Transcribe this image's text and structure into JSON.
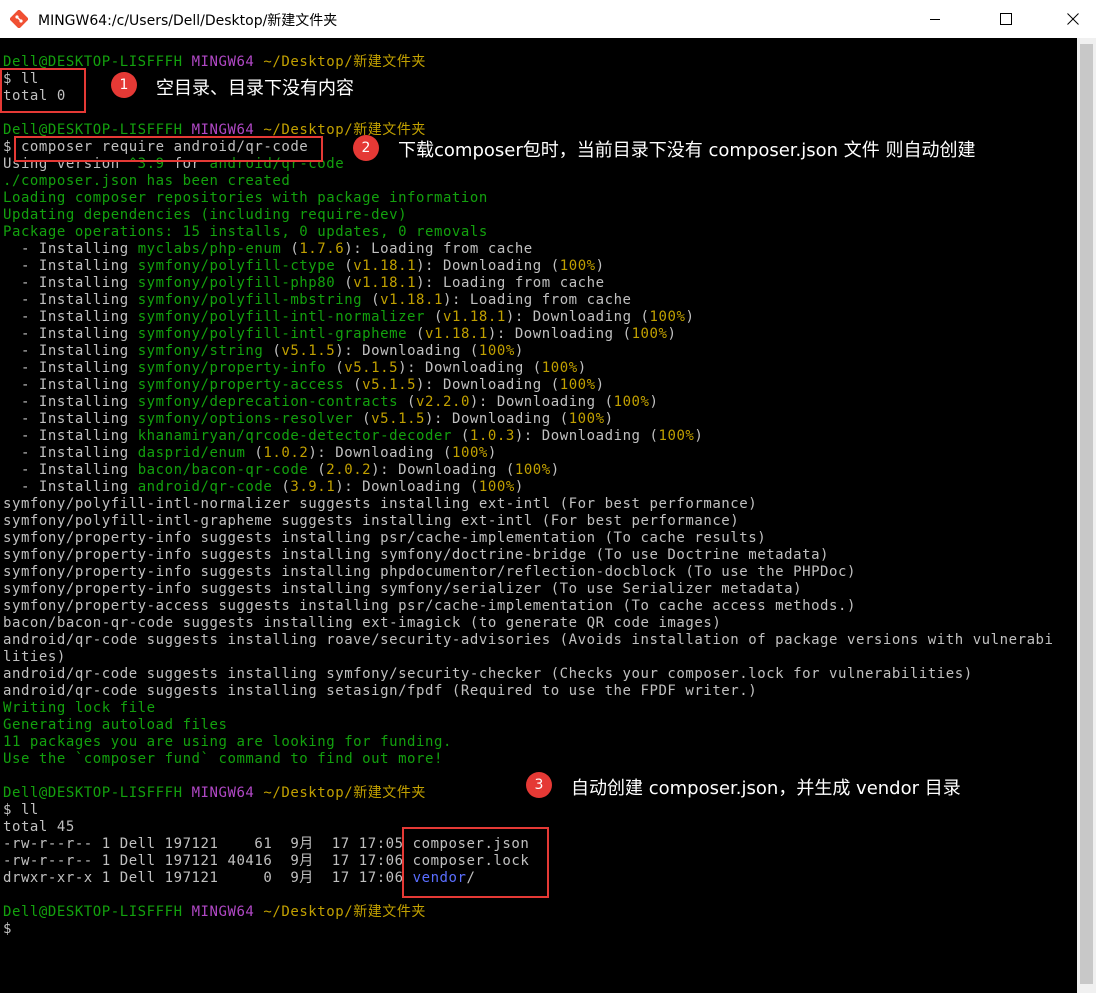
{
  "window": {
    "title": "MINGW64:/c/Users/Dell/Desktop/新建文件夹",
    "icons": [
      "git-bash-icon",
      "minimize-icon",
      "maximize-icon",
      "close-icon"
    ]
  },
  "colors": {
    "default": "#c0c0c0",
    "green": "#13a10e",
    "magenta": "#b148c6",
    "yellow": "#c1a000",
    "blue": "#5a6eff",
    "annotation_red": "#e53935"
  },
  "terminal": {
    "lines": [
      [
        {
          "t": "Dell@DESKTOP-LISFFFH ",
          "c": "green"
        },
        {
          "t": "MINGW64 ",
          "c": "magenta"
        },
        {
          "t": "~/Desktop/新建文件夹",
          "c": "yellow"
        }
      ],
      [
        {
          "t": "$ ll",
          "c": "default"
        }
      ],
      [
        {
          "t": "total 0",
          "c": "default"
        }
      ],
      [],
      [
        {
          "t": "Dell@DESKTOP-LISFFFH ",
          "c": "green"
        },
        {
          "t": "MINGW64 ",
          "c": "magenta"
        },
        {
          "t": "~/Desktop/新建文件夹",
          "c": "yellow"
        }
      ],
      [
        {
          "t": "$ composer require android/qr-code",
          "c": "default"
        }
      ],
      [
        {
          "t": "Using version ",
          "c": "default"
        },
        {
          "t": "^3.9",
          "c": "green"
        },
        {
          "t": " for ",
          "c": "default"
        },
        {
          "t": "android/qr-code",
          "c": "green"
        }
      ],
      [
        {
          "t": "./composer.json has been created",
          "c": "green"
        }
      ],
      [
        {
          "t": "Loading composer repositories with package information",
          "c": "green"
        }
      ],
      [
        {
          "t": "Updating dependencies (including require-dev)",
          "c": "green"
        }
      ],
      [
        {
          "t": "Package operations: 15 installs, 0 updates, 0 removals",
          "c": "green"
        }
      ],
      [
        {
          "t": "  - Installing ",
          "c": "default"
        },
        {
          "t": "myclabs/php-enum",
          "c": "green"
        },
        {
          "t": " (",
          "c": "default"
        },
        {
          "t": "1.7.6",
          "c": "yellow"
        },
        {
          "t": "): Loading from cache",
          "c": "default"
        }
      ],
      [
        {
          "t": "  - Installing ",
          "c": "default"
        },
        {
          "t": "symfony/polyfill-ctype",
          "c": "green"
        },
        {
          "t": " (",
          "c": "default"
        },
        {
          "t": "v1.18.1",
          "c": "yellow"
        },
        {
          "t": "): Downloading (",
          "c": "default"
        },
        {
          "t": "100%",
          "c": "yellow"
        },
        {
          "t": ")",
          "c": "default"
        }
      ],
      [
        {
          "t": "  - Installing ",
          "c": "default"
        },
        {
          "t": "symfony/polyfill-php80",
          "c": "green"
        },
        {
          "t": " (",
          "c": "default"
        },
        {
          "t": "v1.18.1",
          "c": "yellow"
        },
        {
          "t": "): Loading from cache",
          "c": "default"
        }
      ],
      [
        {
          "t": "  - Installing ",
          "c": "default"
        },
        {
          "t": "symfony/polyfill-mbstring",
          "c": "green"
        },
        {
          "t": " (",
          "c": "default"
        },
        {
          "t": "v1.18.1",
          "c": "yellow"
        },
        {
          "t": "): Loading from cache",
          "c": "default"
        }
      ],
      [
        {
          "t": "  - Installing ",
          "c": "default"
        },
        {
          "t": "symfony/polyfill-intl-normalizer",
          "c": "green"
        },
        {
          "t": " (",
          "c": "default"
        },
        {
          "t": "v1.18.1",
          "c": "yellow"
        },
        {
          "t": "): Downloading (",
          "c": "default"
        },
        {
          "t": "100%",
          "c": "yellow"
        },
        {
          "t": ")",
          "c": "default"
        }
      ],
      [
        {
          "t": "  - Installing ",
          "c": "default"
        },
        {
          "t": "symfony/polyfill-intl-grapheme",
          "c": "green"
        },
        {
          "t": " (",
          "c": "default"
        },
        {
          "t": "v1.18.1",
          "c": "yellow"
        },
        {
          "t": "): Downloading (",
          "c": "default"
        },
        {
          "t": "100%",
          "c": "yellow"
        },
        {
          "t": ")",
          "c": "default"
        }
      ],
      [
        {
          "t": "  - Installing ",
          "c": "default"
        },
        {
          "t": "symfony/string",
          "c": "green"
        },
        {
          "t": " (",
          "c": "default"
        },
        {
          "t": "v5.1.5",
          "c": "yellow"
        },
        {
          "t": "): Downloading (",
          "c": "default"
        },
        {
          "t": "100%",
          "c": "yellow"
        },
        {
          "t": ")",
          "c": "default"
        }
      ],
      [
        {
          "t": "  - Installing ",
          "c": "default"
        },
        {
          "t": "symfony/property-info",
          "c": "green"
        },
        {
          "t": " (",
          "c": "default"
        },
        {
          "t": "v5.1.5",
          "c": "yellow"
        },
        {
          "t": "): Downloading (",
          "c": "default"
        },
        {
          "t": "100%",
          "c": "yellow"
        },
        {
          "t": ")",
          "c": "default"
        }
      ],
      [
        {
          "t": "  - Installing ",
          "c": "default"
        },
        {
          "t": "symfony/property-access",
          "c": "green"
        },
        {
          "t": " (",
          "c": "default"
        },
        {
          "t": "v5.1.5",
          "c": "yellow"
        },
        {
          "t": "): Downloading (",
          "c": "default"
        },
        {
          "t": "100%",
          "c": "yellow"
        },
        {
          "t": ")",
          "c": "default"
        }
      ],
      [
        {
          "t": "  - Installing ",
          "c": "default"
        },
        {
          "t": "symfony/deprecation-contracts",
          "c": "green"
        },
        {
          "t": " (",
          "c": "default"
        },
        {
          "t": "v2.2.0",
          "c": "yellow"
        },
        {
          "t": "): Downloading (",
          "c": "default"
        },
        {
          "t": "100%",
          "c": "yellow"
        },
        {
          "t": ")",
          "c": "default"
        }
      ],
      [
        {
          "t": "  - Installing ",
          "c": "default"
        },
        {
          "t": "symfony/options-resolver",
          "c": "green"
        },
        {
          "t": " (",
          "c": "default"
        },
        {
          "t": "v5.1.5",
          "c": "yellow"
        },
        {
          "t": "): Downloading (",
          "c": "default"
        },
        {
          "t": "100%",
          "c": "yellow"
        },
        {
          "t": ")",
          "c": "default"
        }
      ],
      [
        {
          "t": "  - Installing ",
          "c": "default"
        },
        {
          "t": "khanamiryan/qrcode-detector-decoder",
          "c": "green"
        },
        {
          "t": " (",
          "c": "default"
        },
        {
          "t": "1.0.3",
          "c": "yellow"
        },
        {
          "t": "): Downloading (",
          "c": "default"
        },
        {
          "t": "100%",
          "c": "yellow"
        },
        {
          "t": ")",
          "c": "default"
        }
      ],
      [
        {
          "t": "  - Installing ",
          "c": "default"
        },
        {
          "t": "dasprid/enum",
          "c": "green"
        },
        {
          "t": " (",
          "c": "default"
        },
        {
          "t": "1.0.2",
          "c": "yellow"
        },
        {
          "t": "): Downloading (",
          "c": "default"
        },
        {
          "t": "100%",
          "c": "yellow"
        },
        {
          "t": ")",
          "c": "default"
        }
      ],
      [
        {
          "t": "  - Installing ",
          "c": "default"
        },
        {
          "t": "bacon/bacon-qr-code",
          "c": "green"
        },
        {
          "t": " (",
          "c": "default"
        },
        {
          "t": "2.0.2",
          "c": "yellow"
        },
        {
          "t": "): Downloading (",
          "c": "default"
        },
        {
          "t": "100%",
          "c": "yellow"
        },
        {
          "t": ")",
          "c": "default"
        }
      ],
      [
        {
          "t": "  - Installing ",
          "c": "default"
        },
        {
          "t": "android/qr-code",
          "c": "green"
        },
        {
          "t": " (",
          "c": "default"
        },
        {
          "t": "3.9.1",
          "c": "yellow"
        },
        {
          "t": "): Downloading (",
          "c": "default"
        },
        {
          "t": "100%",
          "c": "yellow"
        },
        {
          "t": ")",
          "c": "default"
        }
      ],
      [
        {
          "t": "symfony/polyfill-intl-normalizer suggests installing ext-intl (For best performance)",
          "c": "default"
        }
      ],
      [
        {
          "t": "symfony/polyfill-intl-grapheme suggests installing ext-intl (For best performance)",
          "c": "default"
        }
      ],
      [
        {
          "t": "symfony/property-info suggests installing psr/cache-implementation (To cache results)",
          "c": "default"
        }
      ],
      [
        {
          "t": "symfony/property-info suggests installing symfony/doctrine-bridge (To use Doctrine metadata)",
          "c": "default"
        }
      ],
      [
        {
          "t": "symfony/property-info suggests installing phpdocumentor/reflection-docblock (To use the PHPDoc)",
          "c": "default"
        }
      ],
      [
        {
          "t": "symfony/property-info suggests installing symfony/serializer (To use Serializer metadata)",
          "c": "default"
        }
      ],
      [
        {
          "t": "symfony/property-access suggests installing psr/cache-implementation (To cache access methods.)",
          "c": "default"
        }
      ],
      [
        {
          "t": "bacon/bacon-qr-code suggests installing ext-imagick (to generate QR code images)",
          "c": "default"
        }
      ],
      [
        {
          "t": "android/qr-code suggests installing roave/security-advisories (Avoids installation of package versions with vulnerabi",
          "c": "default"
        }
      ],
      [
        {
          "t": "lities)",
          "c": "default"
        }
      ],
      [
        {
          "t": "android/qr-code suggests installing symfony/security-checker (Checks your composer.lock for vulnerabilities)",
          "c": "default"
        }
      ],
      [
        {
          "t": "android/qr-code suggests installing setasign/fpdf (Required to use the FPDF writer.)",
          "c": "default"
        }
      ],
      [
        {
          "t": "Writing lock file",
          "c": "green"
        }
      ],
      [
        {
          "t": "Generating autoload files",
          "c": "green"
        }
      ],
      [
        {
          "t": "11 packages you are using are looking for funding.",
          "c": "green"
        }
      ],
      [
        {
          "t": "Use the `composer fund` command to find out more!",
          "c": "green"
        }
      ],
      [],
      [
        {
          "t": "Dell@DESKTOP-LISFFFH ",
          "c": "green"
        },
        {
          "t": "MINGW64 ",
          "c": "magenta"
        },
        {
          "t": "~/Desktop/新建文件夹",
          "c": "yellow"
        }
      ],
      [
        {
          "t": "$ ll",
          "c": "default"
        }
      ],
      [
        {
          "t": "total 45",
          "c": "default"
        }
      ],
      [
        {
          "t": "-rw-r--r-- 1 Dell 197121    61  9月  17 17:05 composer.json",
          "c": "default"
        }
      ],
      [
        {
          "t": "-rw-r--r-- 1 Dell 197121 40416  9月  17 17:06 composer.lock",
          "c": "default"
        }
      ],
      [
        {
          "t": "drwxr-xr-x 1 Dell 197121     0  9月  17 17:06 ",
          "c": "default"
        },
        {
          "t": "vendor",
          "c": "blue"
        },
        {
          "t": "/",
          "c": "default"
        }
      ],
      [],
      [
        {
          "t": "Dell@DESKTOP-LISFFFH ",
          "c": "green"
        },
        {
          "t": "MINGW64 ",
          "c": "magenta"
        },
        {
          "t": "~/Desktop/新建文件夹",
          "c": "yellow"
        }
      ],
      [
        {
          "t": "$",
          "c": "default"
        }
      ]
    ]
  },
  "annotations": [
    {
      "number": "1",
      "text": "空目录、目录下没有内容"
    },
    {
      "number": "2",
      "text": "下载composer包时，当前目录下没有 composer.json 文件 则自动创建"
    },
    {
      "number": "3",
      "text": "自动创建 composer.json，并生成 vendor 目录"
    }
  ]
}
